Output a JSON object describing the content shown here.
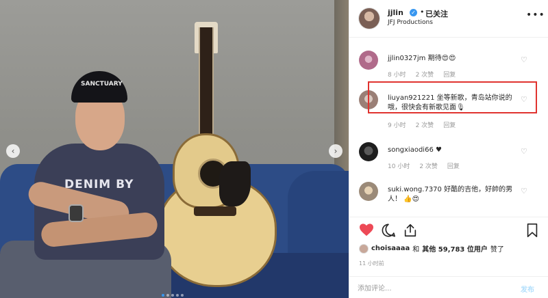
{
  "post": {
    "username": "jjlin",
    "separator": "•",
    "follow_status": "已关注",
    "subtitle": "JFJ Productions",
    "more_label": "•••"
  },
  "photo": {
    "cap_text": "SANCTUARY",
    "shirt_text": "DENIM BY",
    "prev_label": "‹",
    "next_label": "›"
  },
  "comments": [
    {
      "user": "jjlin0327jm",
      "text": "期待😍😍",
      "time": "8 小时",
      "likes": "2 次赞",
      "reply": "回复"
    },
    {
      "user": "liuyan921221",
      "text": "坐等新歌，青岛站你说的哦，很快会有新歌见面🎙",
      "time": "9 小时",
      "likes": "2 次赞",
      "reply": "回复"
    },
    {
      "user": "songxiaodi66",
      "text": "♥",
      "time": "10 小时",
      "likes": "2 次赞",
      "reply": "回复"
    },
    {
      "user": "suki.wong.7370",
      "text": "好酷的吉他，好帥的男人！ 👍😍",
      "time": "",
      "likes": "",
      "reply": ""
    }
  ],
  "likes": {
    "user": "choisaaaa",
    "conj": "和",
    "others": "其他 59,783 位用户",
    "suffix": "赞了"
  },
  "time_ago": "11 小时前",
  "comment_box": {
    "placeholder": "添加评论...",
    "post_label": "发布"
  },
  "colors": {
    "like_red": "#ed4956",
    "verified_blue": "#3897f0",
    "highlight_red": "#e0322e"
  },
  "icons": [
    "heart-icon",
    "comment-icon",
    "share-icon",
    "bookmark-icon",
    "verified-icon",
    "more-icon"
  ]
}
